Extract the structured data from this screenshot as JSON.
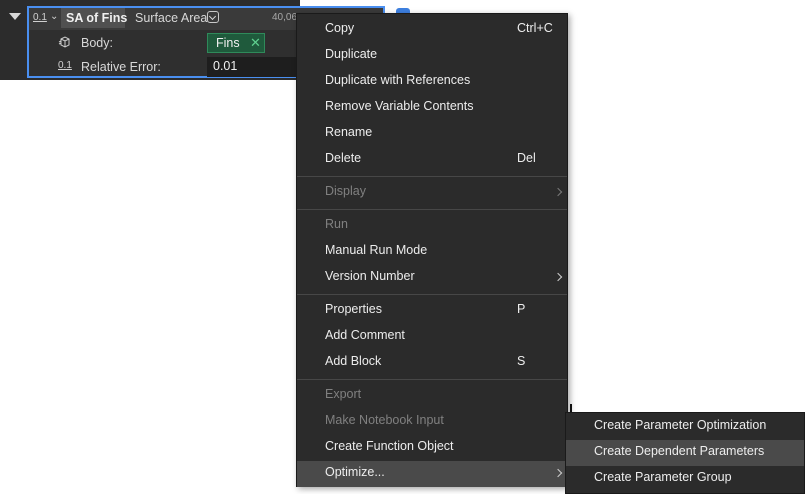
{
  "block": {
    "header": {
      "number_icon": "0.1",
      "name": "SA of Fins",
      "type": "Surface Area",
      "value": "40,06"
    },
    "rows": [
      {
        "label": "Body:",
        "icon": "body-cube-icon",
        "value": "Fins",
        "remove_glyph": "✕"
      },
      {
        "label": "Relative Error:",
        "icon": "0.1",
        "value": "0.01"
      }
    ]
  },
  "context_menu": {
    "items": [
      {
        "label": "Copy",
        "shortcut": "Ctrl+C"
      },
      {
        "label": "Duplicate",
        "shortcut": ""
      },
      {
        "label": "Duplicate with References",
        "shortcut": ""
      },
      {
        "label": "Remove Variable Contents",
        "shortcut": ""
      },
      {
        "label": "Rename",
        "shortcut": ""
      },
      {
        "label": "Delete",
        "shortcut": "Del"
      },
      {
        "label": "Display",
        "shortcut": "",
        "disabled": true,
        "submenu": true
      },
      {
        "label": "Run",
        "shortcut": "",
        "disabled": true
      },
      {
        "label": "Manual Run Mode",
        "shortcut": ""
      },
      {
        "label": "Version Number",
        "shortcut": "",
        "submenu": true
      },
      {
        "label": "Properties",
        "shortcut": "P"
      },
      {
        "label": "Add Comment",
        "shortcut": ""
      },
      {
        "label": "Add Block",
        "shortcut": "S"
      },
      {
        "label": "Export",
        "shortcut": "",
        "disabled": true
      },
      {
        "label": "Make Notebook Input",
        "shortcut": "",
        "disabled": true
      },
      {
        "label": "Create Function Object",
        "shortcut": ""
      },
      {
        "label": "Optimize...",
        "shortcut": "",
        "submenu": true,
        "highlighted": true
      }
    ]
  },
  "optimize_submenu": {
    "items": [
      {
        "label": "Create Parameter Optimization"
      },
      {
        "label": "Create Dependent Parameters",
        "highlighted": true
      },
      {
        "label": "Create Parameter Group"
      }
    ]
  },
  "colors": {
    "selection_border": "#4a8ff0",
    "menu_bg": "#2b2b2b",
    "highlight_bg": "#4a4a4a",
    "tag_bg": "#1f5a3c"
  }
}
